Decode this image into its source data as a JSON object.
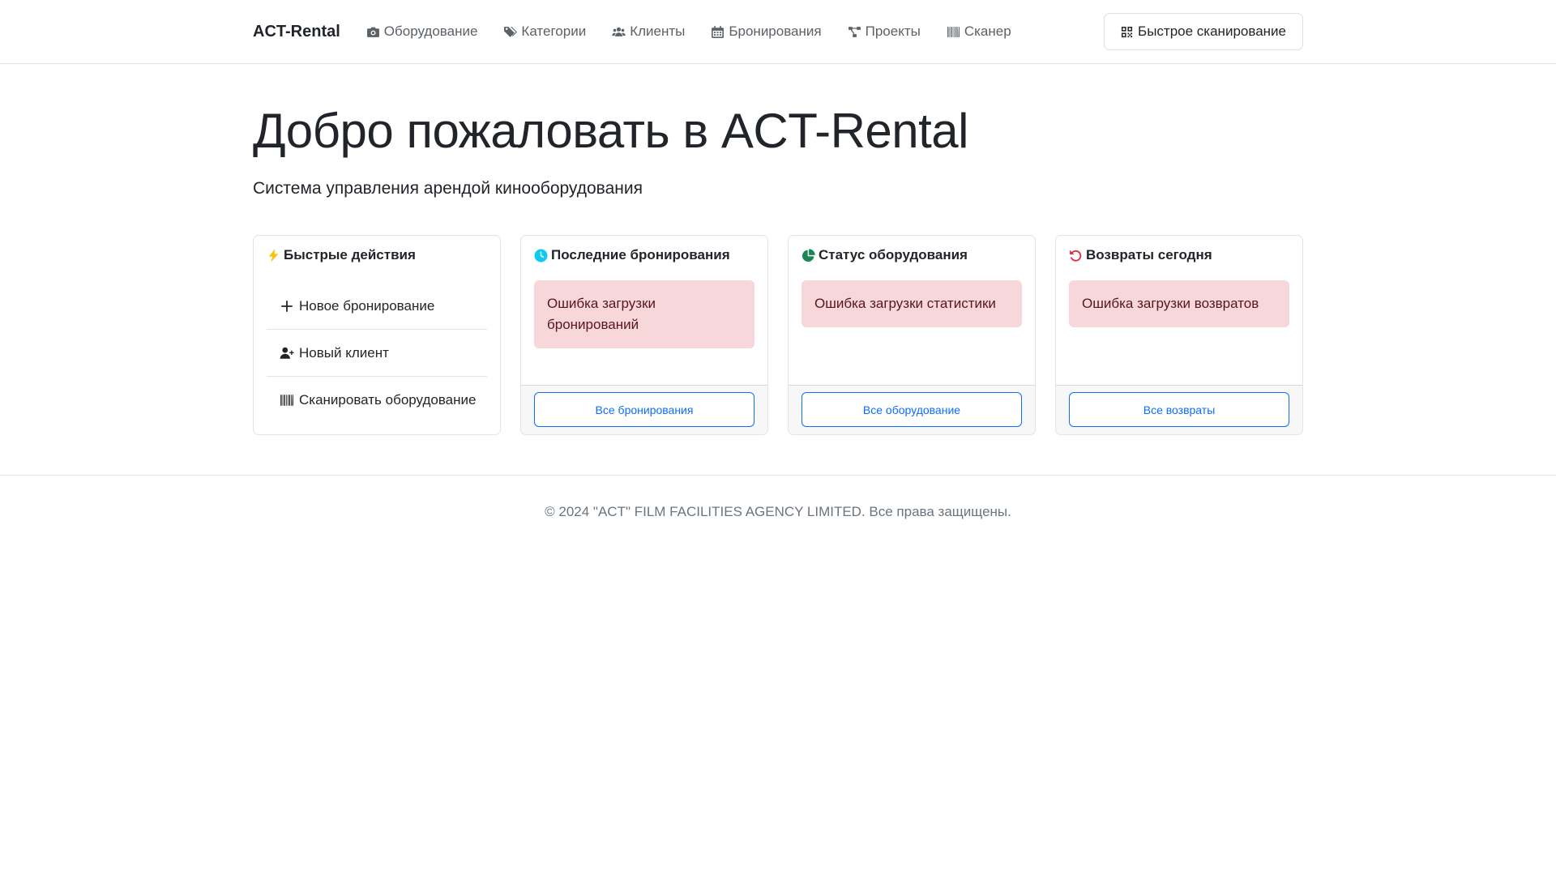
{
  "navbar": {
    "brand": "ACT-Rental",
    "links": [
      {
        "label": "Оборудование",
        "icon": "camera-icon"
      },
      {
        "label": "Категории",
        "icon": "tags-icon"
      },
      {
        "label": "Клиенты",
        "icon": "users-icon"
      },
      {
        "label": "Бронирования",
        "icon": "calendar-icon"
      },
      {
        "label": "Проекты",
        "icon": "project-diagram-icon"
      },
      {
        "label": "Сканер",
        "icon": "barcode-icon"
      }
    ],
    "quick_scan": {
      "label": "Быстрое сканирование",
      "icon": "qrcode-icon"
    }
  },
  "main": {
    "title": "Добро пожаловать в ACT-Rental",
    "lead": "Система управления арендой кинооборудования"
  },
  "cards": {
    "quick_actions": {
      "title": "Быстрые действия",
      "icon": "bolt-icon",
      "icon_color": "#ffc107",
      "items": [
        {
          "label": "Новое бронирование",
          "icon": "plus-icon"
        },
        {
          "label": "Новый клиент",
          "icon": "user-plus-icon"
        },
        {
          "label": "Сканировать оборудование",
          "icon": "barcode-icon"
        }
      ]
    },
    "recent_bookings": {
      "title": "Последние бронирования",
      "icon": "clock-icon",
      "icon_color": "#0dcaf0",
      "error": "Ошибка загрузки бронирований",
      "button": "Все бронирования"
    },
    "equipment_status": {
      "title": "Статус оборудования",
      "icon": "chart-pie-icon",
      "icon_color": "#198754",
      "error": "Ошибка загрузки статистики",
      "button": "Все оборудование"
    },
    "returns_today": {
      "title": "Возвраты сегодня",
      "icon": "undo-icon",
      "icon_color": "#dc3545",
      "error": "Ошибка загрузки возвратов",
      "button": "Все возвраты"
    }
  },
  "footer": {
    "text": "© 2024 \"ACT\" FILM FACILITIES AGENCY LIMITED. Все права защищены."
  },
  "colors": {
    "primary": "#0d6efd",
    "alert_bg": "#f8d7da",
    "alert_text": "#58151c",
    "muted": "#6c757d"
  }
}
